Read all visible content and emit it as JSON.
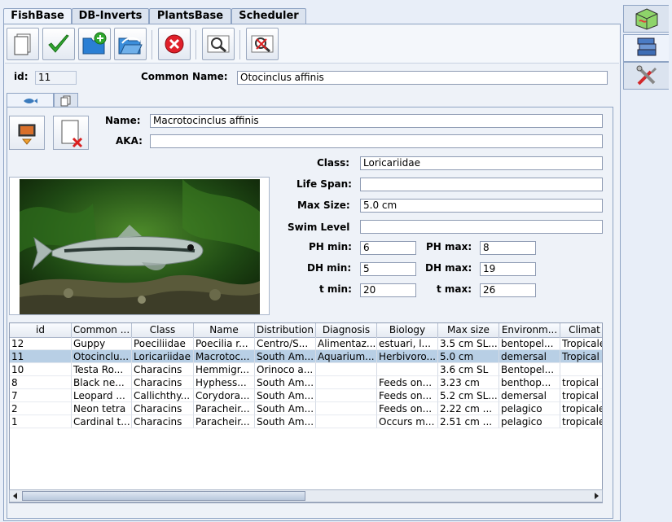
{
  "main_tabs": [
    "FishBase",
    "DB-Inverts",
    "PlantsBase",
    "Scheduler"
  ],
  "toolbar": {
    "buttons": [
      "new-icon",
      "save-check-icon",
      "add-folder-icon",
      "open-folder-icon",
      "delete-icon",
      "search-icon",
      "clear-search-icon"
    ]
  },
  "record": {
    "id_label": "id:",
    "id_value": "11",
    "common_name_label": "Common Name:",
    "common_name_value": "Otocinclus affinis"
  },
  "details": {
    "name_label": "Name:",
    "name_value": "Macrotocinclus affinis",
    "aka_label": "AKA:",
    "aka_value": "",
    "class_label": "Class:",
    "class_value": "Loricariidae",
    "lifespan_label": "Life Span:",
    "lifespan_value": "",
    "maxsize_label": "Max Size:",
    "maxsize_value": "5.0 cm",
    "swimlevel_label": "Swim Level",
    "swimlevel_value": "",
    "phmin_label": "PH min:",
    "phmin_value": "6",
    "phmax_label": "PH max:",
    "phmax_value": "8",
    "dhmin_label": "DH min:",
    "dhmin_value": "5",
    "dhmax_label": "DH max:",
    "dhmax_value": "19",
    "tmin_label": "t min:",
    "tmin_value": "20",
    "tmax_label": "t max:",
    "tmax_value": "26"
  },
  "table": {
    "columns": [
      "id",
      "Common ...",
      "Class",
      "Name",
      "Distribution",
      "Diagnosis",
      "Biology",
      "Max size",
      "Environm...",
      "Climat"
    ],
    "rows": [
      [
        "12",
        "Guppy",
        "Poeciliidae",
        "Poecilia r...",
        "Centro/S...",
        "Alimentaz...",
        "estuari, l...",
        "3.5 cm SL...",
        "bentopel...",
        "Tropicale"
      ],
      [
        "11",
        "Otocinclu...",
        "Loricariidae",
        "Macrotoc...",
        "South Am...",
        "Aquarium...",
        "Herbivoro...",
        "5.0 cm",
        "demersal",
        "Tropical"
      ],
      [
        "10",
        "Testa Ro...",
        "Characins",
        "Hemmigr...",
        "Orinoco a...",
        "",
        "",
        "3.6 cm SL",
        "Bentopel...",
        ""
      ],
      [
        "8",
        "Black ne...",
        "Characins",
        "Hyphess...",
        "South Am...",
        "",
        "Feeds on...",
        "3.23 cm",
        "benthop...",
        "tropical"
      ],
      [
        "7",
        "Leopard ...",
        "Callichthy...",
        "Corydora...",
        "South Am...",
        "",
        "Feeds on...",
        "5.2 cm SL...",
        "demersal",
        "tropical"
      ],
      [
        "2",
        "Neon tetra",
        "Characins",
        "Paracheir...",
        "South Am...",
        "",
        "Feeds on...",
        "2.22 cm ...",
        "pelagico",
        "tropicale"
      ],
      [
        "1",
        "Cardinal t...",
        "Characins",
        "Paracheir...",
        "South Am...",
        "",
        "Occurs m...",
        "2.51 cm ...",
        "pelagico",
        "tropicale"
      ]
    ],
    "selected_index": 1
  },
  "side_tabs": [
    "aquarium-icon",
    "books-icon",
    "tools-icon"
  ],
  "colors": {
    "accent": "#8fa4c4",
    "selection": "#b8cfe5",
    "panel": "#eef2f8"
  }
}
